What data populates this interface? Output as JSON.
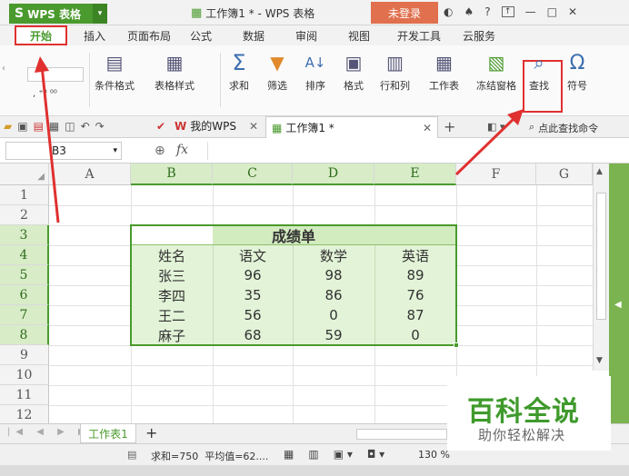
{
  "title_bar": {
    "app_name": "WPS 表格",
    "doc_title": "工作簿1 * - WPS 表格",
    "login": "未登录",
    "help": "?",
    "minimize": "—",
    "maximize": "□",
    "close": "✕"
  },
  "menu": [
    "开始",
    "插入",
    "页面布局",
    "公式",
    "数据",
    "审阅",
    "视图",
    "开发工具",
    "云服务"
  ],
  "ribbon": {
    "cond_format": "条件格式",
    "table_style": "表格样式",
    "sum": "求和",
    "filter": "筛选",
    "sort": "排序",
    "format": "格式",
    "row_col": "行和列",
    "worksheet": "工作表",
    "freeze": "冻结窗格",
    "find": "查找",
    "symbol": "符号"
  },
  "doc_tabs": {
    "my_wps": "我的WPS",
    "workbook": "工作簿1 *",
    "search_cmd": "点此查找命令"
  },
  "formula_bar": {
    "cell_ref": "B3",
    "fx": "fx"
  },
  "columns": [
    "A",
    "B",
    "C",
    "D",
    "E",
    "F",
    "G"
  ],
  "rows": [
    "1",
    "2",
    "3",
    "4",
    "5",
    "6",
    "7",
    "8",
    "9",
    "10",
    "11",
    "12"
  ],
  "table": {
    "title": "成绩单",
    "headers": [
      "姓名",
      "语文",
      "数学",
      "英语"
    ],
    "data": [
      [
        "张三",
        "96",
        "98",
        "89"
      ],
      [
        "李四",
        "35",
        "86",
        "76"
      ],
      [
        "王二",
        "56",
        "0",
        "87"
      ],
      [
        "麻子",
        "68",
        "59",
        "0"
      ]
    ]
  },
  "sheet_tab": "工作表1",
  "status": {
    "summary": "求和=750  平均值=62....",
    "zoom": "130 %"
  },
  "watermark": {
    "title": "百科全说",
    "subtitle": "助你轻松解决"
  },
  "colors": {
    "brand_green": "#4a9a2d",
    "highlight_red": "#e03030",
    "table_fill": "#e2f3d7"
  }
}
